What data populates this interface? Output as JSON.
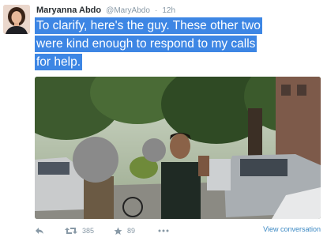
{
  "tweet": {
    "name": "Maryanna Abdo",
    "handle": "@MaryAbdo",
    "separator": "·",
    "time": "12h",
    "text_lines": [
      "To clarify, here's the guy. These other two",
      "were kind enough to respond to my calls",
      "for help."
    ],
    "highlight_color": "#3d86e4"
  },
  "actions": {
    "reply_icon": "reply-icon",
    "retweet_count": "385",
    "favorite_count": "89",
    "more_icon": "more-icon",
    "view_conversation": "View conversation",
    "link_color": "#3b88c3"
  }
}
